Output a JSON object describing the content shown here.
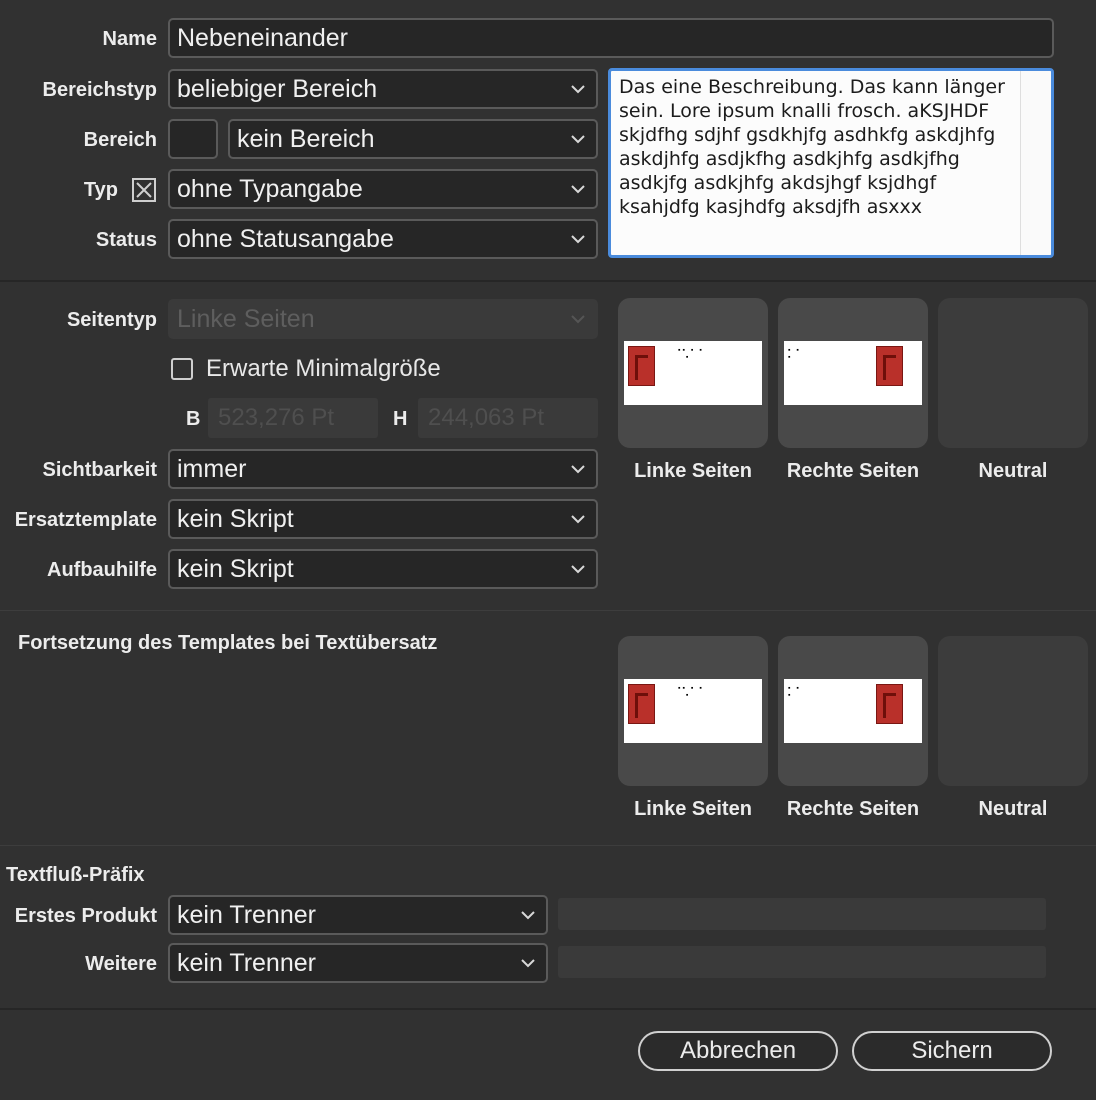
{
  "form": {
    "name": {
      "label": "Name",
      "value": "Nebeneinander"
    },
    "bereichstyp": {
      "label": "Bereichstyp",
      "value": "beliebiger Bereich"
    },
    "bereich": {
      "label": "Bereich",
      "value": "kein Bereich"
    },
    "typ": {
      "label": "Typ",
      "value": "ohne Typangabe"
    },
    "status": {
      "label": "Status",
      "value": "ohne Statusangabe"
    },
    "description": "Das eine Beschreibung. Das kann länger sein. Lore ipsum knalli frosch. aKSJHDF skjdfhg sdjhf gsdkhjfg asdhkfg askdjhfg askdjhfg asdjkfhg asdkjhfg asdkjfhg asdkjfg asdkjhfg akdsjhgf ksjdhgf ksahjdfg kasjhdfg aksdjfh asxxx"
  },
  "page": {
    "seitentyp": {
      "label": "Seitentyp",
      "value": "Linke Seiten",
      "disabled": true
    },
    "min_size": {
      "label": "Erwarte Minimalgröße",
      "checked": false
    },
    "width": {
      "label": "B",
      "placeholder": "523,276 Pt"
    },
    "height": {
      "label": "H",
      "placeholder": "244,063 Pt"
    },
    "sichtbarkeit": {
      "label": "Sichtbarkeit",
      "value": "immer"
    },
    "ersatztemplate": {
      "label": "Ersatztemplate",
      "value": "kein Skript"
    },
    "aufbauhilfe": {
      "label": "Aufbauhilfe",
      "value": "kein Skript"
    },
    "thumbnails": [
      {
        "label": "Linke Seiten"
      },
      {
        "label": "Rechte Seiten"
      },
      {
        "label": "Neutral"
      }
    ]
  },
  "continuation": {
    "title": "Fortsetzung des Templates bei Textübersatz",
    "thumbnails": [
      {
        "label": "Linke Seiten"
      },
      {
        "label": "Rechte Seiten"
      },
      {
        "label": "Neutral"
      }
    ]
  },
  "textflow": {
    "title": "Textfluß-Präfix",
    "first": {
      "label": "Erstes Produkt",
      "value": "kein Trenner"
    },
    "further": {
      "label": "Weitere",
      "value": "kein Trenner"
    }
  },
  "buttons": {
    "cancel": "Abbrechen",
    "save": "Sichern"
  },
  "colors": {
    "background": "#313131",
    "field": "#262626",
    "focus_border": "#4a8bdc",
    "thumbnail_red": "#b9302a"
  }
}
